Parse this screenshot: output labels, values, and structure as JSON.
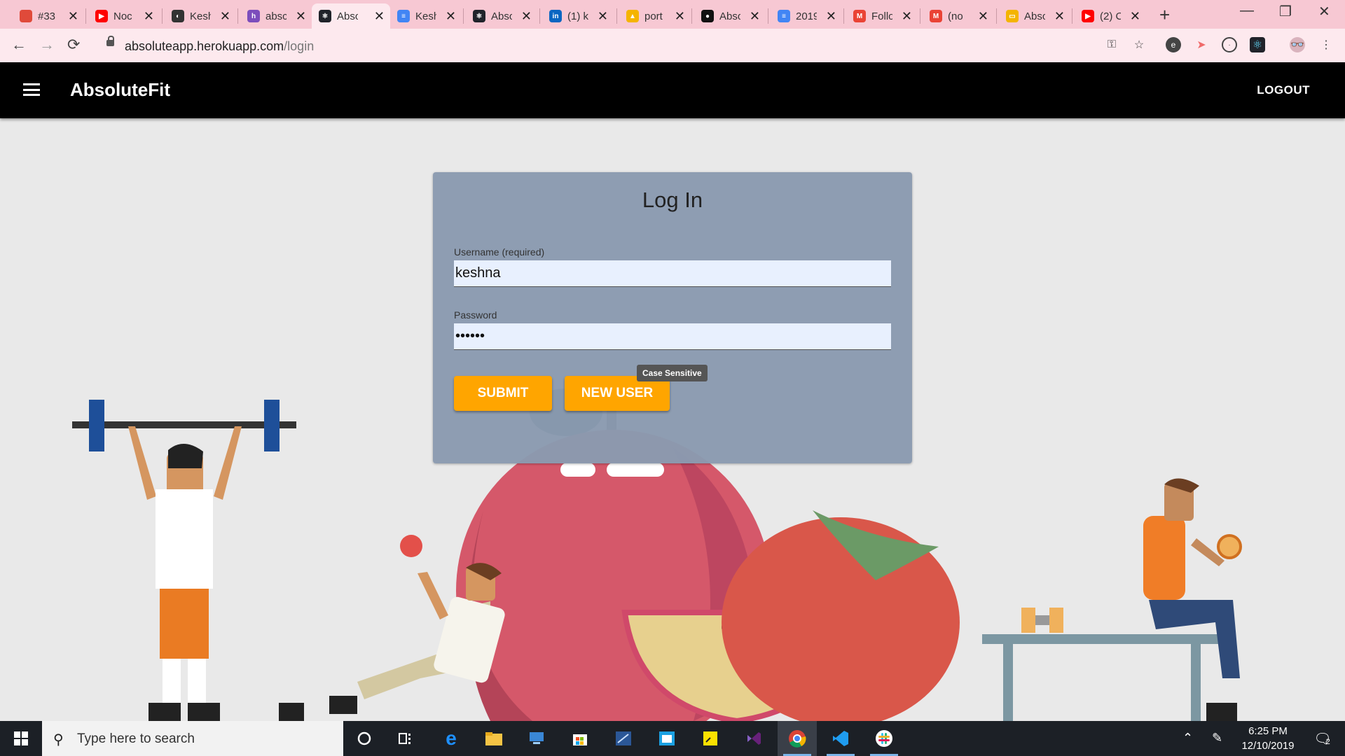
{
  "browser": {
    "tabs": [
      {
        "label": "#33",
        "color": "#e04a3a",
        "icon": "chrome-canary-icon",
        "glyph": ""
      },
      {
        "label": "Noc",
        "color": "#ff0000",
        "icon": "youtube-icon",
        "glyph": "▶"
      },
      {
        "label": "Kesh",
        "color": "#333333",
        "icon": "globe-icon",
        "glyph": "◐"
      },
      {
        "label": "absc",
        "color": "#7c4dbc",
        "icon": "heroku-icon",
        "glyph": "h"
      },
      {
        "label": "Abso",
        "color": "#20232a",
        "icon": "react-icon",
        "glyph": "⚛",
        "active": true
      },
      {
        "label": "Kesh",
        "color": "#4285f4",
        "icon": "google-docs-icon",
        "glyph": "≡"
      },
      {
        "label": "Abso",
        "color": "#20232a",
        "icon": "react-icon",
        "glyph": "⚛"
      },
      {
        "label": "(1) k",
        "color": "#0a66c2",
        "icon": "linkedin-icon",
        "glyph": "in"
      },
      {
        "label": "port",
        "color": "#f5b400",
        "icon": "google-drive-icon",
        "glyph": "▲"
      },
      {
        "label": "Abso",
        "color": "#111111",
        "icon": "github-icon",
        "glyph": "●"
      },
      {
        "label": "2019",
        "color": "#4285f4",
        "icon": "google-docs-icon",
        "glyph": "≡"
      },
      {
        "label": "Follo",
        "color": "#ea4335",
        "icon": "gmail-icon",
        "glyph": "M"
      },
      {
        "label": "(no",
        "color": "#ea4335",
        "icon": "gmail-icon",
        "glyph": "M"
      },
      {
        "label": "Abso",
        "color": "#f4b400",
        "icon": "google-slides-icon",
        "glyph": "▭"
      },
      {
        "label": "(2) C",
        "color": "#ff0000",
        "icon": "youtube-icon",
        "glyph": "▶"
      }
    ],
    "url_host": "absoluteapp.herokuapp.com",
    "url_path": "/login"
  },
  "app": {
    "brand": "AbsoluteFit",
    "logout_label": "LOGOUT"
  },
  "login": {
    "title": "Log In",
    "username_label": "Username (required)",
    "username_value": "keshna",
    "password_label": "Password",
    "password_value": "••••••",
    "submit_label": "SUBMIT",
    "new_user_label": "NEW USER",
    "tooltip": "Case Sensitive"
  },
  "taskbar": {
    "search_placeholder": "Type here to search",
    "time": "6:25 PM",
    "date": "12/10/2019",
    "notification_count": "2"
  },
  "colors": {
    "accent": "#ffa500",
    "card": "#8a9ab0",
    "appbar": "#000000",
    "tabstrip": "#f7c8d3"
  }
}
